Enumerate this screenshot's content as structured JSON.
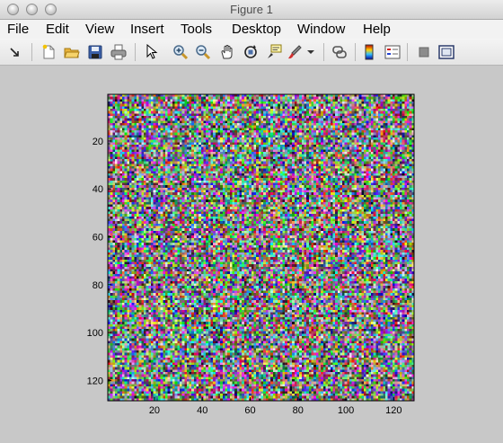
{
  "window": {
    "title": "Figure 1",
    "controls": [
      "close",
      "minimize",
      "zoom"
    ]
  },
  "menu": [
    "File",
    "Edit",
    "View",
    "Insert",
    "Tools",
    "Desktop",
    "Window",
    "Help"
  ],
  "toolbar": {
    "icons": [
      "dock-arrow-icon",
      "new-figure-icon",
      "open-file-icon",
      "save-icon",
      "print-icon",
      "edit-plot-icon",
      "zoom-in-icon",
      "zoom-out-icon",
      "pan-icon",
      "rotate-3d-icon",
      "data-cursor-icon",
      "brush-icon",
      "brush-dropdown-icon",
      "link-plot-icon",
      "colorbar-icon",
      "legend-icon",
      "hide-plot-tools-icon",
      "show-plot-tools-icon"
    ]
  },
  "chart_data": {
    "type": "heatmap",
    "description_rows": 128,
    "description_cols": 128,
    "colormap": "random RGB per pixel",
    "xlim": [
      0.5,
      128.5
    ],
    "ylim": [
      0.5,
      128.5
    ],
    "y_direction": "reverse",
    "xticks": [
      20,
      40,
      60,
      80,
      100,
      120
    ],
    "yticks": [
      20,
      40,
      60,
      80,
      100,
      120
    ]
  }
}
